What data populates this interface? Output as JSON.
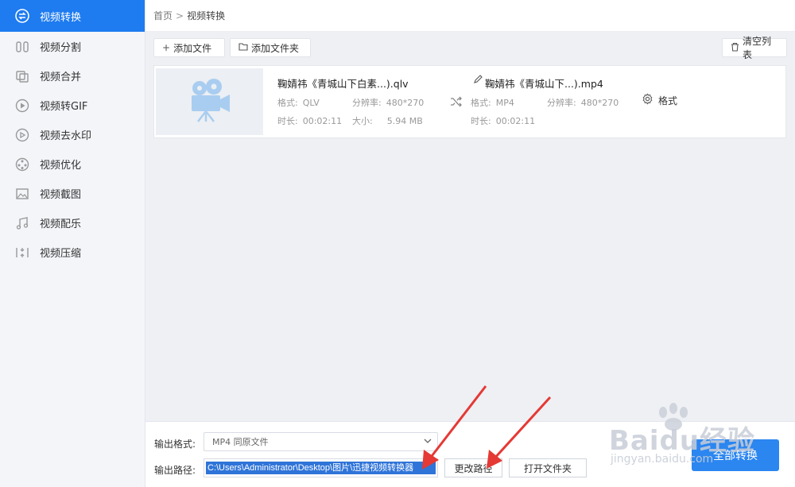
{
  "sidebar": {
    "items": [
      {
        "label": "视频转换",
        "icon": "convert-icon",
        "active": true
      },
      {
        "label": "视频分割",
        "icon": "split-icon",
        "active": false
      },
      {
        "label": "视频合并",
        "icon": "merge-icon",
        "active": false
      },
      {
        "label": "视频转GIF",
        "icon": "gif-icon",
        "active": false
      },
      {
        "label": "视频去水印",
        "icon": "watermark-remove-icon",
        "active": false
      },
      {
        "label": "视频优化",
        "icon": "optimize-icon",
        "active": false
      },
      {
        "label": "视频截图",
        "icon": "screenshot-icon",
        "active": false
      },
      {
        "label": "视频配乐",
        "icon": "music-icon",
        "active": false
      },
      {
        "label": "视频压缩",
        "icon": "compress-icon",
        "active": false
      }
    ]
  },
  "breadcrumb": {
    "home": "首页",
    "separator": ">",
    "current": "视频转换"
  },
  "toolbar": {
    "add_file": "添加文件",
    "add_folder": "添加文件夹",
    "clear_list": "清空列表"
  },
  "file": {
    "source": {
      "name": "鞠婧祎《青城山下白素...).qlv",
      "format_label": "格式:",
      "format": "QLV",
      "resolution_label": "分辨率:",
      "resolution": "480*270",
      "duration_label": "时长:",
      "duration": "00:02:11",
      "size_label": "大小:",
      "size": "5.94 MB"
    },
    "target": {
      "name": "鞠婧祎《青城山下...).mp4",
      "format_label": "格式:",
      "format": "MP4",
      "resolution_label": "分辨率:",
      "resolution": "480*270",
      "duration_label": "时长:",
      "duration": "00:02:11"
    },
    "format_button": "格式"
  },
  "output": {
    "format_label": "输出格式:",
    "format_value": "MP4  同原文件",
    "path_label": "输出路径:",
    "path_value": "C:\\Users\\Administrator\\Desktop\\图片\\迅捷视频转换器",
    "change_path": "更改路径",
    "open_folder": "打开文件夹",
    "convert_all": "全部转换"
  },
  "watermark": {
    "text": "Baidu经验",
    "sub": "jingyan.baidu.com"
  },
  "colors": {
    "accent": "#1e7bf0",
    "arrow": "#e53935",
    "sidebar_bg": "#f3f5f9",
    "main_bg": "#eef0f4"
  }
}
